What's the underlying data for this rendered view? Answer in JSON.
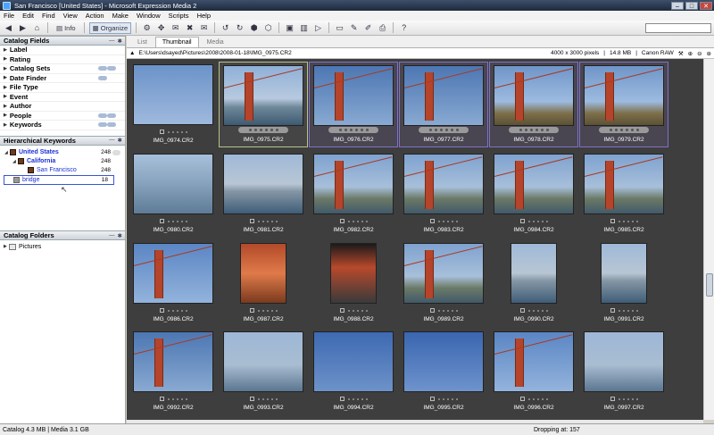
{
  "window": {
    "title": "San Francisco [United States] - Microsoft Expression Media 2"
  },
  "menu": [
    "File",
    "Edit",
    "Find",
    "View",
    "Action",
    "Make",
    "Window",
    "Scripts",
    "Help"
  ],
  "toolbar": {
    "info_label": "Info",
    "organize_label": "Organize",
    "search_placeholder": ""
  },
  "sidebar": {
    "catalog_fields_title": "Catalog Fields",
    "fields": [
      "Label",
      "Rating",
      "Catalog Sets",
      "Date Finder",
      "File Type",
      "Event",
      "Author",
      "People",
      "Keywords"
    ],
    "hier_title": "Hierarchical Keywords",
    "keywords": [
      {
        "label": "United States",
        "count": "248"
      },
      {
        "label": "California",
        "count": "248"
      },
      {
        "label": "San Francisco",
        "count": "248"
      },
      {
        "label": "bridge",
        "count": "18"
      }
    ],
    "folders_title": "Catalog Folders",
    "folders": [
      "Pictures"
    ]
  },
  "tabs": [
    "List",
    "Thumbnail",
    "Media"
  ],
  "pathbar": {
    "path": "E:\\Users\\dsayed\\Pictures\\2008\\2008-01-18\\IMG_0975.CR2",
    "dims": "4000 x 3000 pixels",
    "size": "14.8 MB",
    "camera": "Canon RAW"
  },
  "thumbnails": [
    {
      "name": "IMG_0974.CR2",
      "scene": "heli"
    },
    {
      "name": "IMG_0975.CR2",
      "scene": "bridge-dist"
    },
    {
      "name": "IMG_0976.CR2",
      "scene": "tower"
    },
    {
      "name": "IMG_0977.CR2",
      "scene": "tower"
    },
    {
      "name": "IMG_0978.CR2",
      "scene": "tower-hill"
    },
    {
      "name": "IMG_0979.CR2",
      "scene": "tower-hill"
    },
    {
      "name": "IMG_0980.CR2",
      "scene": "bay-boat"
    },
    {
      "name": "IMG_0981.CR2",
      "scene": "city"
    },
    {
      "name": "IMG_0982.CR2",
      "scene": "bridge-span"
    },
    {
      "name": "IMG_0983.CR2",
      "scene": "bridge-span"
    },
    {
      "name": "IMG_0984.CR2",
      "scene": "bridge-span"
    },
    {
      "name": "IMG_0985.CR2",
      "scene": "bridge-span"
    },
    {
      "name": "IMG_0986.CR2",
      "scene": "cable"
    },
    {
      "name": "IMG_0987.CR2",
      "scene": "redclose"
    },
    {
      "name": "IMG_0988.CR2",
      "scene": "redtower"
    },
    {
      "name": "IMG_0989.CR2",
      "scene": "bridge-span"
    },
    {
      "name": "IMG_0990.CR2",
      "scene": "city"
    },
    {
      "name": "IMG_0991.CR2",
      "scene": "city"
    },
    {
      "name": "IMG_0992.CR2",
      "scene": "tower"
    },
    {
      "name": "IMG_0993.CR2",
      "scene": "bay"
    },
    {
      "name": "IMG_0994.CR2",
      "scene": "sky"
    },
    {
      "name": "IMG_0995.CR2",
      "scene": "bird"
    },
    {
      "name": "IMG_0996.CR2",
      "scene": "cable"
    },
    {
      "name": "IMG_0997.CR2",
      "scene": "bay"
    }
  ],
  "status": {
    "left": "Catalog  4.3 MB  |  Media 3.1 GB",
    "right": "Dropping at: 157"
  }
}
